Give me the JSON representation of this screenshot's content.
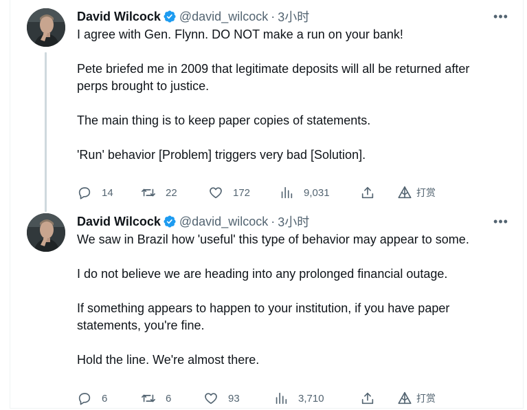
{
  "tweets": [
    {
      "author_name": "David Wilcock",
      "handle": "@david_wilcock",
      "separator": "·",
      "time": "3小时",
      "paragraphs": [
        [
          "I agree with Gen. Flynn. DO NOT make a run on your bank!"
        ],
        [
          "Pete briefed me in 2009 that legitimate deposits will all be returned after",
          "perps brought to justice."
        ],
        [
          "The main thing is to keep paper copies of statements."
        ],
        [
          "'Run' behavior [Problem] triggers very bad [Solution]."
        ]
      ],
      "p": {
        "0": "I agree with Gen. Flynn. DO NOT make a run on your bank!",
        "1a": "Pete briefed me in 2009 that legitimate deposits will all be returned after",
        "1b": "perps brought to justice.",
        "2": "The main thing is to keep paper copies of statements.",
        "3": "'Run' behavior [Problem] triggers very bad [Solution]."
      },
      "stats": {
        "replies": "14",
        "reposts": "22",
        "likes": "172",
        "views": "9,031",
        "tip_label": "打赏"
      }
    },
    {
      "author_name": "David Wilcock",
      "handle": "@david_wilcock",
      "separator": "·",
      "time": "3小时",
      "p": {
        "0": "We saw in Brazil how 'useful' this type of behavior may appear to some.",
        "1": "I do not believe we are heading into any prolonged financial outage.",
        "2a": "If something appears to happen to your institution, if you have paper",
        "2b": "statements, you're fine.",
        "3": "Hold the line. We're almost there."
      },
      "stats": {
        "replies": "6",
        "reposts": "6",
        "likes": "93",
        "views": "3,710",
        "tip_label": "打赏"
      }
    }
  ],
  "icons": {
    "verified": "verified-badge-icon",
    "more": "more-dots-icon",
    "reply": "reply-bubble-icon",
    "repost": "repost-arrows-icon",
    "like": "heart-icon",
    "views": "bar-chart-icon",
    "share": "share-upload-icon",
    "tip": "triangle-tip-icon"
  },
  "colors": {
    "text": "#0f1419",
    "secondary": "#536471",
    "verified": "#1d9bf0",
    "thread_line": "#cfd9de"
  }
}
